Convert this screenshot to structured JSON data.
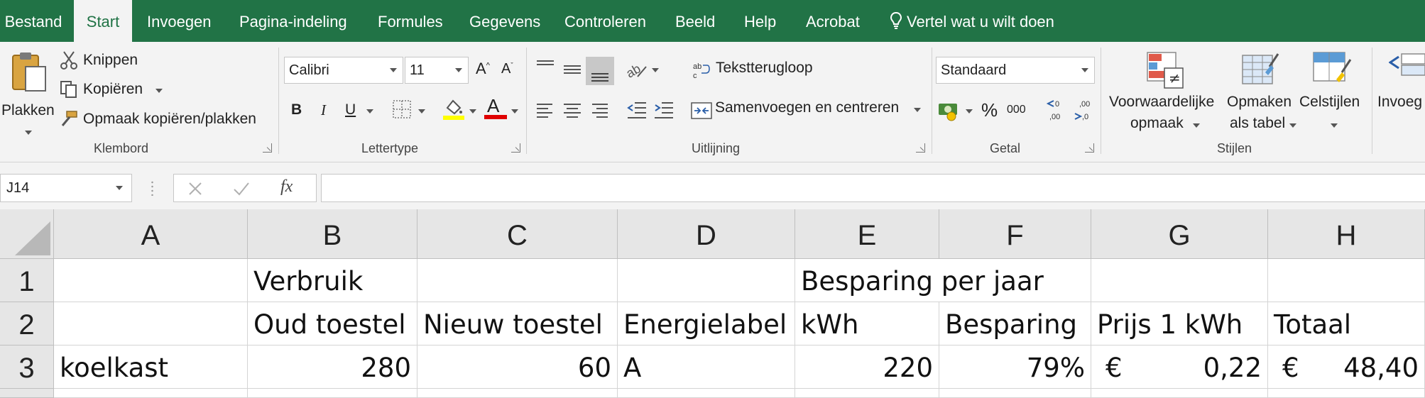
{
  "menu": {
    "tabs": [
      "Bestand",
      "Start",
      "Invoegen",
      "Pagina-indeling",
      "Formules",
      "Gegevens",
      "Controleren",
      "Beeld",
      "Help",
      "Acrobat"
    ],
    "active_tab": "Start",
    "tell_me": "Vertel wat u wilt doen"
  },
  "colors": {
    "accent": "#217346",
    "ribbon_bg": "#f3f3f3"
  },
  "ribbon": {
    "clipboard": {
      "paste": "Plakken",
      "cut": "Knippen",
      "copy": "Kopiëren",
      "format_painter": "Opmaak kopiëren/plakken",
      "label": "Klembord"
    },
    "font": {
      "name": "Calibri",
      "size": "11",
      "bold": "B",
      "italic": "I",
      "underline": "U",
      "label": "Lettertype"
    },
    "alignment": {
      "wrap": "Tekstterugloop",
      "merge": "Samenvoegen en centreren",
      "label": "Uitlijning"
    },
    "number": {
      "format": "Standaard",
      "percent": "%",
      "thousands": "000",
      "label": "Getal"
    },
    "styles": {
      "conditional_line1": "Voorwaardelijke",
      "conditional_line2": "opmaak",
      "as_table_line1": "Opmaken",
      "as_table_line2": "als tabel",
      "cell_styles": "Celstijlen",
      "label": "Stijlen"
    },
    "cells": {
      "insert": "Invoeg"
    }
  },
  "formula_bar": {
    "name_box": "J14",
    "fx": "fx",
    "formula": ""
  },
  "grid": {
    "columns": [
      "A",
      "B",
      "C",
      "D",
      "E",
      "F",
      "G",
      "H"
    ],
    "rows": [
      "1",
      "2",
      "3"
    ],
    "cells": {
      "B1": "Verbruik",
      "E1": "Besparing per jaar",
      "B2": "Oud toestel",
      "C2": "Nieuw toestel",
      "D2": "Energielabel",
      "E2": "kWh",
      "F2": "Besparing",
      "G2": "Prijs 1 kWh",
      "H2": "Totaal",
      "A3": "koelkast",
      "B3": "280",
      "C3": "60",
      "D3": "A",
      "E3": "220",
      "F3": "79%",
      "G3_currency": "€",
      "G3": "0,22",
      "H3_currency": "€",
      "H3": "48,40"
    }
  }
}
